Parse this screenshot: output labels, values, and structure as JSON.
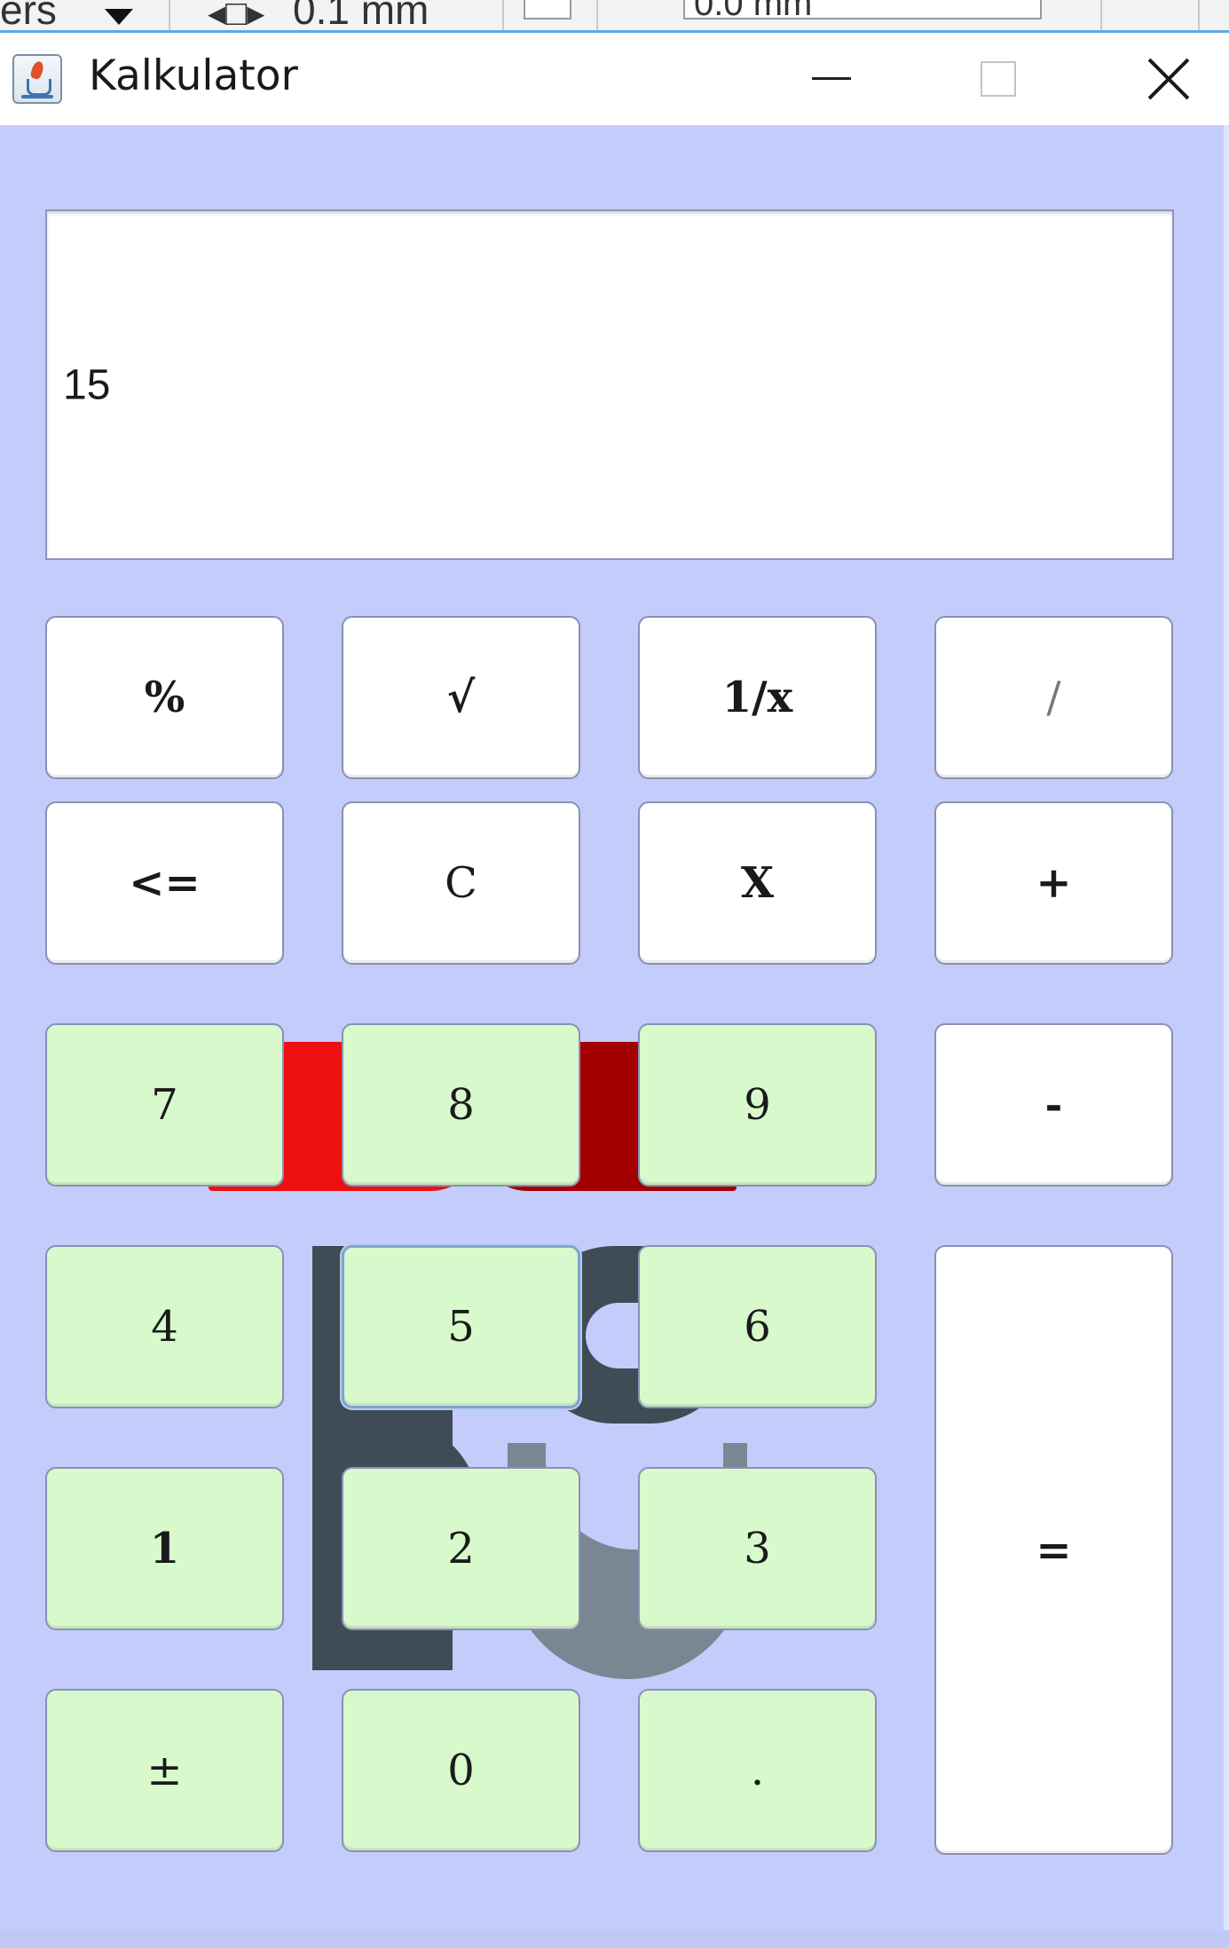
{
  "background_app": {
    "toolbar_text_1": "ers",
    "toolbar_text_2": "0.1 mm",
    "toolbar_text_3": "0.0 mm"
  },
  "window": {
    "title": "Kalkulator",
    "controls": {
      "minimize": "minimize",
      "maximize": "maximize",
      "close": "close"
    }
  },
  "display": {
    "value": "15"
  },
  "keypad": {
    "percent": "%",
    "sqrt": "√",
    "reciprocal": "1/x",
    "divide": "/",
    "backspace": "<=",
    "clear": "C",
    "multiply": "X",
    "plus": "+",
    "seven": "7",
    "eight": "8",
    "nine": "9",
    "minus": "-",
    "four": "4",
    "five": "5",
    "six": "6",
    "equals": "=",
    "one": "1",
    "two": "2",
    "three": "3",
    "plus_minus": "±",
    "zero": "0",
    "decimal": "."
  },
  "colors": {
    "body_background": "#c4ccfb",
    "number_key": "#d7f9cb",
    "operator_key": "#ffffff",
    "logo_red": "#ee1010",
    "logo_dark_red": "#a30000",
    "logo_gray": "#3f4c56"
  }
}
